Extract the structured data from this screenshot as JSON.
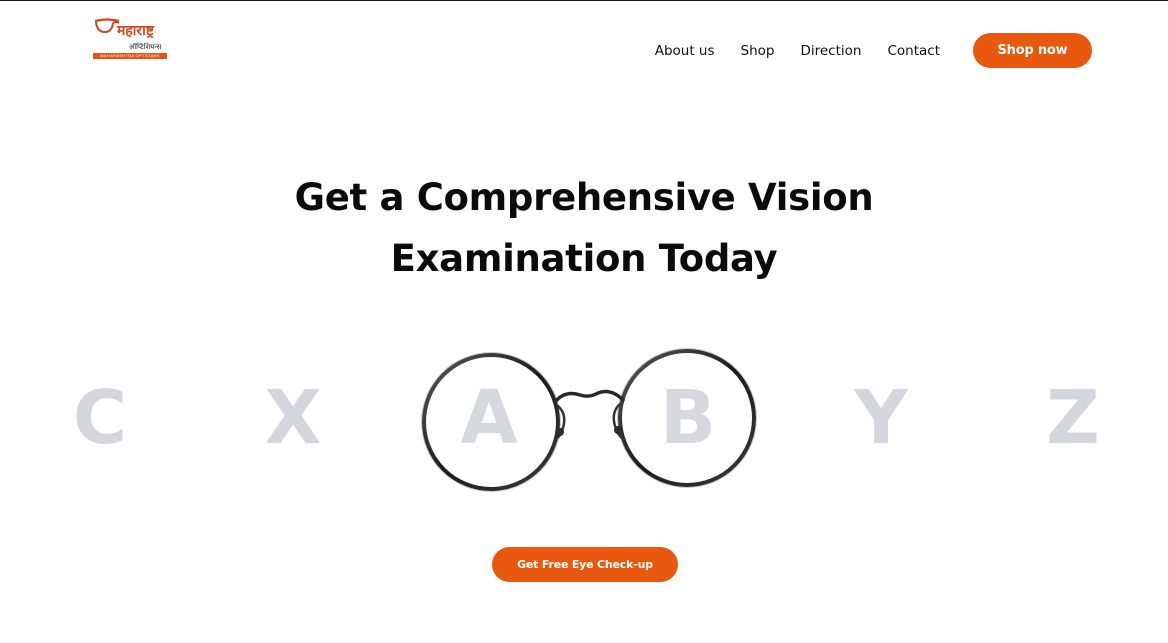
{
  "brand": {
    "logo_script": "महाराष्ट्र",
    "logo_tagline": "ऑप्टिशियन्स",
    "logo_subtext": "MAHARASHTRA OPTICIANS",
    "accent_color": "#e8590f"
  },
  "nav": {
    "items": [
      {
        "label": "About us"
      },
      {
        "label": "Shop"
      },
      {
        "label": "Direction"
      },
      {
        "label": "Contact"
      }
    ],
    "shop_button_label": "Shop now"
  },
  "hero": {
    "title_line1": "Get a Comprehensive Vision",
    "title_line2": "Examination Today",
    "eye_chart_letters": [
      "C",
      "X",
      "A",
      "B",
      "Y",
      "Z"
    ],
    "illustration": "round-eyeglasses",
    "cta_label": "Get Free Eye Check-up"
  }
}
